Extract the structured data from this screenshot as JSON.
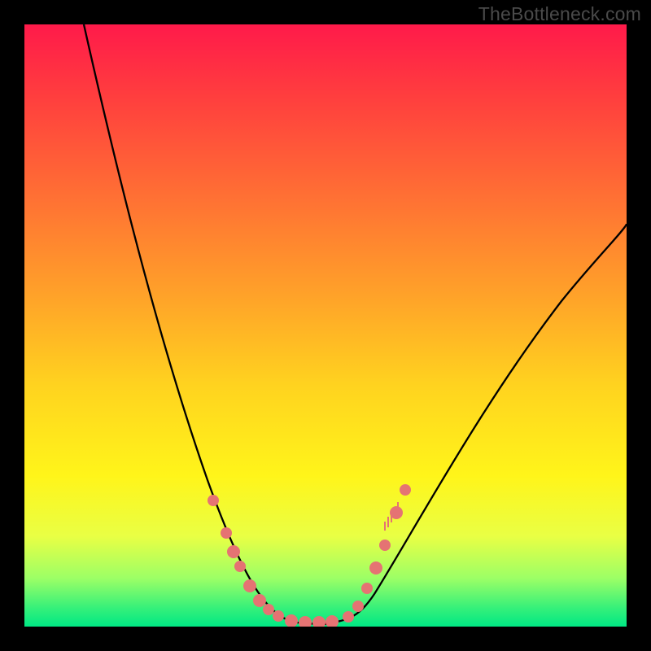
{
  "watermark": "TheBottleneck.com",
  "chart_data": {
    "type": "line",
    "title": "",
    "xlabel": "",
    "ylabel": "",
    "xlim": [
      0,
      1
    ],
    "ylim": [
      0,
      1
    ],
    "background_gradient": [
      "#ff1a4a",
      "#ff7433",
      "#ffd31f",
      "#fff51a",
      "#34f07a"
    ],
    "series": [
      {
        "name": "left-curve",
        "x": [
          0.1,
          0.15,
          0.22,
          0.3,
          0.37,
          0.43,
          0.47,
          0.5
        ],
        "y": [
          1.0,
          0.8,
          0.55,
          0.3,
          0.12,
          0.03,
          0.01,
          0.0
        ]
      },
      {
        "name": "right-curve",
        "x": [
          0.5,
          0.55,
          0.6,
          0.66,
          0.73,
          0.82,
          0.92,
          1.0
        ],
        "y": [
          0.0,
          0.02,
          0.06,
          0.14,
          0.26,
          0.42,
          0.58,
          0.67
        ]
      },
      {
        "name": "dots",
        "type": "scatter",
        "x": [
          0.31,
          0.34,
          0.35,
          0.36,
          0.37,
          0.39,
          0.41,
          0.42,
          0.44,
          0.47,
          0.49,
          0.51,
          0.54,
          0.55,
          0.57,
          0.58,
          0.6,
          0.62,
          0.63
        ],
        "y": [
          0.21,
          0.16,
          0.13,
          0.1,
          0.07,
          0.05,
          0.03,
          0.02,
          0.01,
          0.01,
          0.01,
          0.01,
          0.02,
          0.03,
          0.06,
          0.1,
          0.13,
          0.19,
          0.23
        ]
      }
    ]
  }
}
